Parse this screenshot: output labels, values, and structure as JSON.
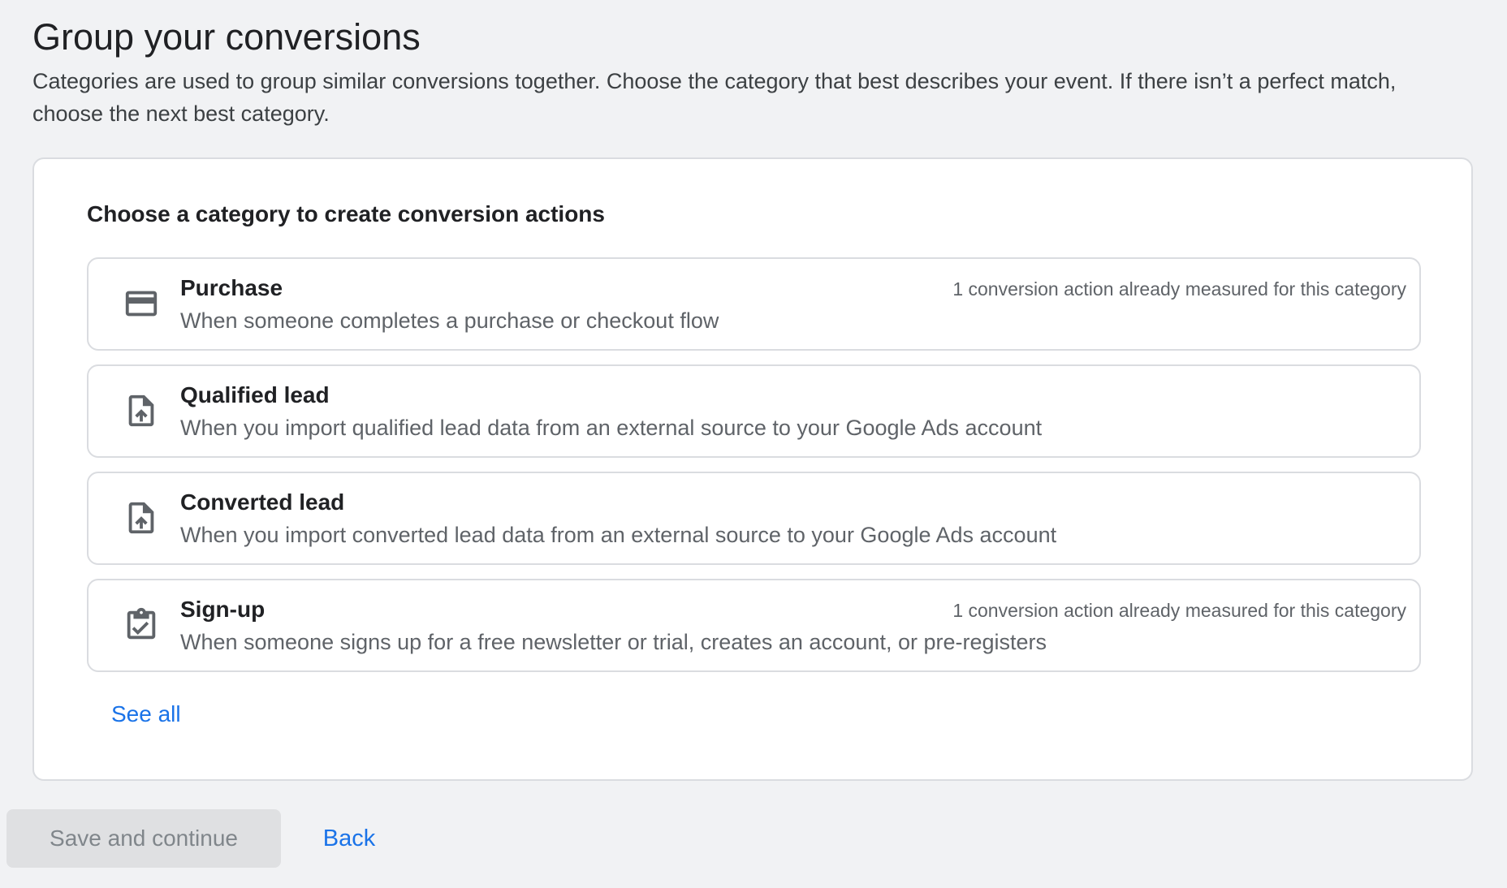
{
  "header": {
    "title": "Group your conversions",
    "description": "Categories are used to group similar conversions together. Choose the category that best describes your event. If there isn’t a perfect match, choose the next best category."
  },
  "card": {
    "title": "Choose a category to create conversion actions",
    "options": [
      {
        "icon": "credit-card-icon",
        "title": "Purchase",
        "description": "When someone completes a purchase or checkout flow",
        "note": "1 conversion action already measured for this category"
      },
      {
        "icon": "file-upload-icon",
        "title": "Qualified lead",
        "description": "When you import qualified lead data from an external source to your Google Ads account",
        "note": ""
      },
      {
        "icon": "file-upload-icon",
        "title": "Converted lead",
        "description": "When you import converted lead data from an external source to your Google Ads account",
        "note": ""
      },
      {
        "icon": "clipboard-check-icon",
        "title": "Sign-up",
        "description": "When someone signs up for a free newsletter or trial, creates an account, or pre-registers",
        "note": "1 conversion action already measured for this category"
      }
    ],
    "see_all_label": "See all"
  },
  "footer": {
    "save_label": "Save and continue",
    "back_label": "Back"
  },
  "colors": {
    "accent": "#1a73e8",
    "background": "#f1f2f4",
    "disabled_button": "#dfe0e2"
  }
}
